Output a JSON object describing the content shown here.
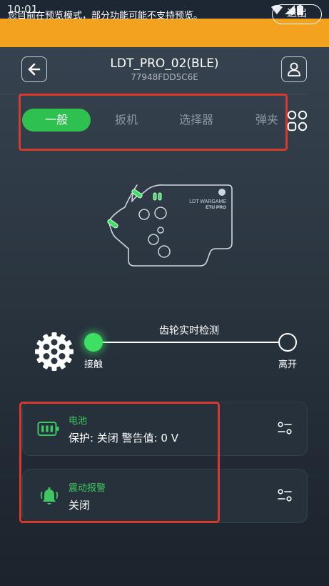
{
  "status_bar": {
    "time": "10:01"
  },
  "banner": {
    "text": "您目前在预览模式，部分功能可能不支持预览。",
    "exit_label": "退出"
  },
  "header": {
    "device_name": "LDT_PRO_02(BLE)",
    "device_id": "77948FDD5C6E"
  },
  "tabs": [
    {
      "label": "一般",
      "active": true
    },
    {
      "label": "扳机",
      "active": false
    },
    {
      "label": "选择器",
      "active": false
    },
    {
      "label": "弹夹",
      "active": false
    }
  ],
  "board": {
    "brand_line1": "LDT WARGAME",
    "brand_line2": "ETU PRO"
  },
  "gear_detection": {
    "title": "齿轮实时检测",
    "contact_label": "接触",
    "leave_label": "离开",
    "state": "接触"
  },
  "cards": {
    "battery": {
      "title": "电池",
      "value": "保护:  关闭 警告值: 0 V"
    },
    "vibration": {
      "title": "震动报警",
      "value": "关闭"
    }
  },
  "colors": {
    "accent_green": "#2ec14f",
    "banner_orange": "#f2a21e",
    "highlight_red": "#d8392c",
    "background": "#2b3641"
  },
  "icons": {
    "back": "arrow-left-icon",
    "profile": "user-icon",
    "grid": "grid-icon",
    "battery": "battery-icon",
    "vibration": "bell-alarm-icon",
    "settings": "sliders-icon",
    "gear": "gear-icon"
  }
}
